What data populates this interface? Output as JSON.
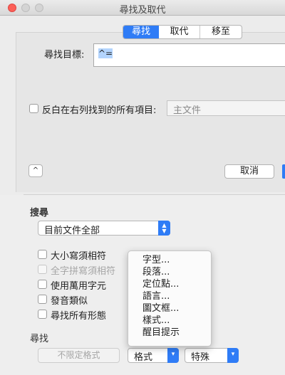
{
  "window": {
    "title": "尋找及取代"
  },
  "tabs": [
    "尋找",
    "取代",
    "移至"
  ],
  "find": {
    "label": "尋找目標:",
    "value": "^="
  },
  "highlight": {
    "label": "反白在右列找到的所有項目:",
    "target": "主文件"
  },
  "buttons": {
    "collapse": "^",
    "cancel": "取消"
  },
  "search": {
    "title": "搜尋",
    "scope": "目前文件全部",
    "options": [
      {
        "label": "大小寫須相符",
        "enabled": true
      },
      {
        "label": "全字拼寫須相符",
        "enabled": false
      },
      {
        "label": "使用萬用字元",
        "enabled": true
      },
      {
        "label": "發音類似",
        "enabled": true
      },
      {
        "label": "尋找所有形態",
        "enabled": true
      }
    ]
  },
  "find_section": {
    "title": "尋找",
    "no_format": "不限定格式",
    "format": "格式",
    "special": "特殊"
  },
  "format_menu": [
    "字型...",
    "段落...",
    "定位點...",
    "語言...",
    "圖文框...",
    "樣式...",
    "醒目提示"
  ],
  "colors": {
    "accent": "#2f7cf6",
    "close": "#fc5f57"
  }
}
